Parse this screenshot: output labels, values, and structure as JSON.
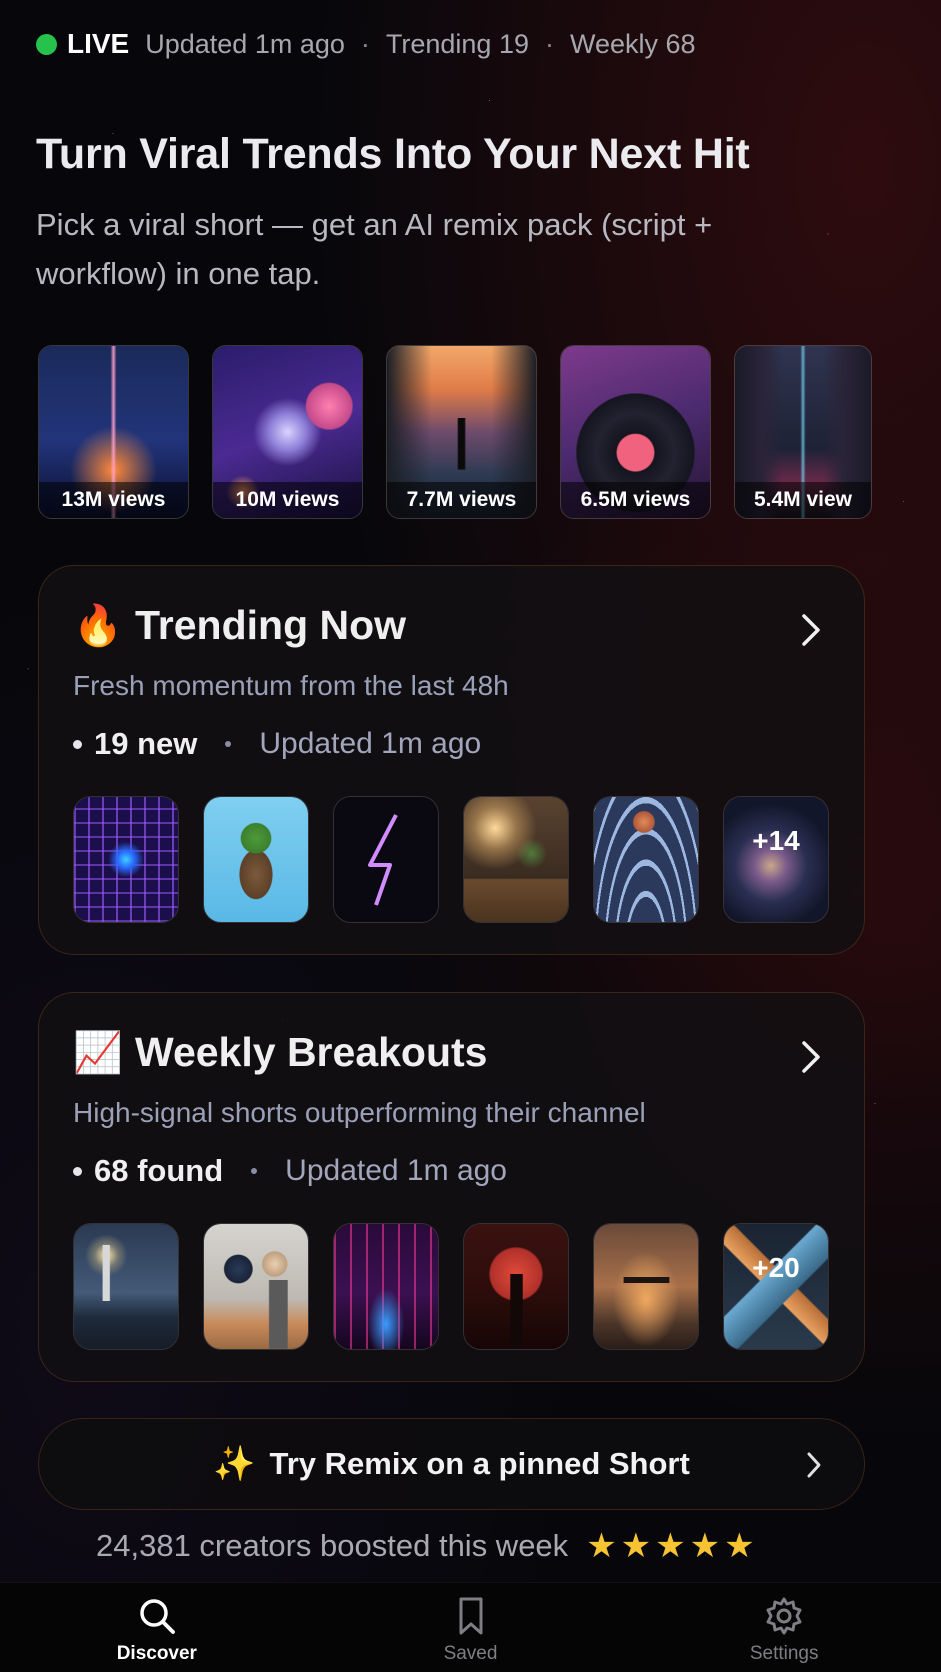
{
  "status": {
    "live_label": "LIVE",
    "updated": "Updated 1m ago",
    "sep1": "·",
    "trending": "Trending 19",
    "sep2": "·",
    "weekly": "Weekly 68",
    "live_color": "#27c24c"
  },
  "hero": {
    "title": "Turn Viral Trends Into Your Next Hit",
    "subtitle": "Pick a viral short — get an AI remix pack (script + workflow) in one tap."
  },
  "top_shorts": [
    {
      "views": "13M views",
      "art": "glowing-pyramid"
    },
    {
      "views": "10M views",
      "art": "astronaut-planets"
    },
    {
      "views": "7.7M views",
      "art": "canyon-silhouette"
    },
    {
      "views": "6.5M views",
      "art": "vinyl-record"
    },
    {
      "views": "5.4M view",
      "art": "neon-city-street"
    }
  ],
  "trending": {
    "emoji": "🔥",
    "title": "Trending Now",
    "subtitle": "Fresh momentum from the last 48h",
    "count": "19 new",
    "updated": "Updated 1m ago",
    "thumbs": [
      "neon-tunnel",
      "floating-island",
      "neon-lightning",
      "desk-lamp",
      "moon-waves"
    ],
    "more": "+14"
  },
  "weekly": {
    "emoji": "📈",
    "title": "Weekly Breakouts",
    "subtitle": "High-signal shorts outperforming their channel",
    "count": "68 found",
    "updated": "Updated 1m ago",
    "thumbs": [
      "lighthouse",
      "abstract-spheres",
      "neon-corridor",
      "samurai-moon",
      "drone-dusk"
    ],
    "more": "+20"
  },
  "remix": {
    "sparkle": "✨",
    "label": "Try Remix on a pinned Short"
  },
  "social_proof": {
    "text": "24,381 creators boosted this week",
    "rating": 5
  },
  "tabs": [
    {
      "label": "Discover",
      "icon": "search-icon",
      "active": true
    },
    {
      "label": "Saved",
      "icon": "bookmark-icon",
      "active": false
    },
    {
      "label": "Settings",
      "icon": "gear-icon",
      "active": false
    }
  ]
}
